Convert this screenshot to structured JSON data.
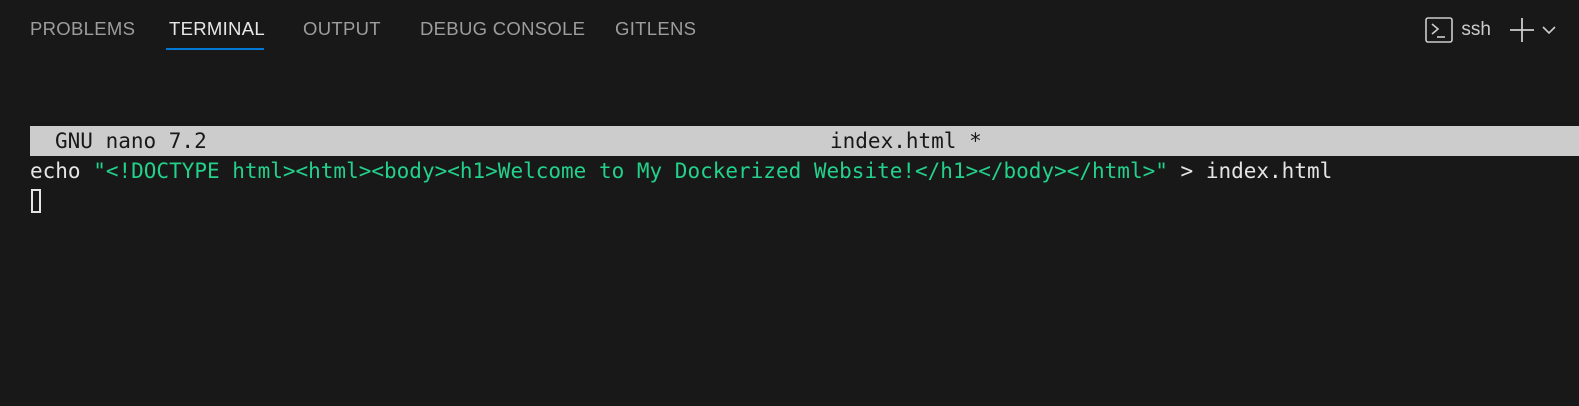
{
  "tabs": [
    {
      "label": "PROBLEMS",
      "active": false
    },
    {
      "label": "TERMINAL",
      "active": true
    },
    {
      "label": "OUTPUT",
      "active": false
    },
    {
      "label": "DEBUG CONSOLE",
      "active": false
    },
    {
      "label": "GITLENS",
      "active": false
    }
  ],
  "actions": {
    "terminal_profile_icon": "terminal-icon",
    "profile_label": "ssh",
    "new_terminal_icon": "plus-icon",
    "dropdown_icon": "chevron-down-icon"
  },
  "nano": {
    "version": "GNU nano 7.2",
    "filename": "index.html *"
  },
  "terminal": {
    "line1": {
      "command": "echo ",
      "string": "\"<!DOCTYPE html><html><body><h1>Welcome to My Dockerized Website!</h1></body></html>\"",
      "redirect": " > index.html"
    }
  },
  "colors": {
    "background": "#181818",
    "active_tab": "#e7e7e7",
    "inactive_tab": "#9d9d9d",
    "tab_underline": "#0078d4",
    "nano_header_bg": "#cccccc",
    "string_green": "#23d18b",
    "text": "#e5e5e5"
  }
}
